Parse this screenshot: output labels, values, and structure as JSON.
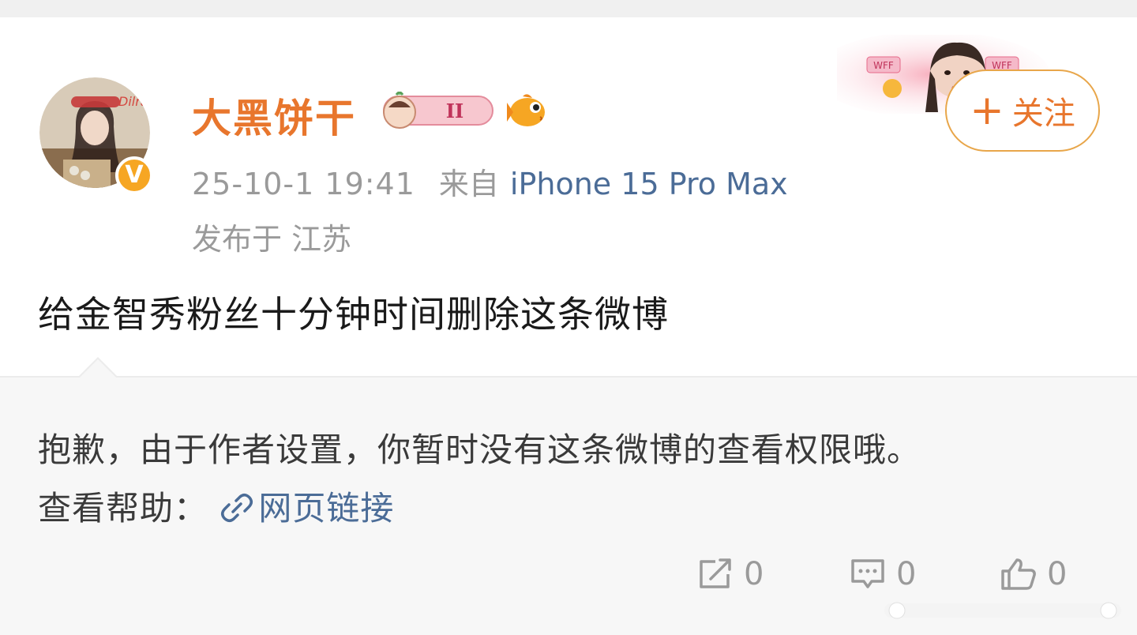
{
  "user": {
    "name": "大黑饼干",
    "avatar_text": "Dilraba",
    "verified_badge": "V",
    "level_badge": "II"
  },
  "post": {
    "time": "25-10-1 19:41",
    "from_label": "来自",
    "device": "iPhone 15 Pro Max",
    "location": "发布于 江苏",
    "text": "给金智秀粉丝十分钟时间删除这条微博"
  },
  "header": {
    "banner_text": "WFF",
    "follow_label": "关注",
    "follow_plus": "+"
  },
  "retweet": {
    "notice": "抱歉，由于作者设置，你暂时没有这条微博的查看权限哦。",
    "help_label": "查看帮助：",
    "link_text": "网页链接"
  },
  "actions": {
    "repost_count": "0",
    "comment_count": "0",
    "like_count": "0"
  },
  "colors": {
    "name": "#e8762d",
    "link": "#4b6c97",
    "meta": "#9a9a9a",
    "follow_border": "#e8a64a"
  }
}
